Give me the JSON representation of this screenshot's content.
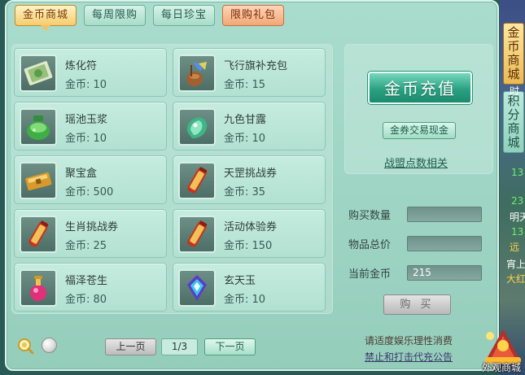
{
  "tabs": [
    {
      "label": "金币商城",
      "active": true
    },
    {
      "label": "每周限购",
      "active": false
    },
    {
      "label": "每日珍宝",
      "active": false
    },
    {
      "label": "限购礼包",
      "active": false
    }
  ],
  "items": [
    {
      "name": "炼化符",
      "price": "金币: 10",
      "icon": "talisman-icon"
    },
    {
      "name": "飞行旗补充包",
      "price": "金币: 15",
      "icon": "flag-pack-icon"
    },
    {
      "name": "瑶池玉浆",
      "price": "金币: 10",
      "icon": "jade-potion-icon"
    },
    {
      "name": "九色甘露",
      "price": "金币: 10",
      "icon": "dew-gem-icon"
    },
    {
      "name": "聚宝盒",
      "price": "金币: 500",
      "icon": "treasure-box-icon"
    },
    {
      "name": "天罡挑战券",
      "price": "金币: 35",
      "icon": "scroll-icon"
    },
    {
      "name": "生肖挑战券",
      "price": "金币: 25",
      "icon": "scroll-icon"
    },
    {
      "name": "活动体验券",
      "price": "金币: 150",
      "icon": "scroll-icon"
    },
    {
      "name": "福泽苍生",
      "price": "金币: 80",
      "icon": "perfume-bottle-icon"
    },
    {
      "name": "玄天玉",
      "price": "金币: 10",
      "icon": "xuantian-jade-icon"
    }
  ],
  "right": {
    "recharge_label": "金币充值",
    "exchange_label": "金券交易现金",
    "alliance_link": "战盟点数相关"
  },
  "form": {
    "quantity_label": "购买数量",
    "quantity_value": "",
    "total_label": "物品总价",
    "total_value": "",
    "current_label": "当前金币",
    "current_value": "215",
    "buy_label": "购 买"
  },
  "pagination": {
    "prev_label": "上一页",
    "page": "1/3",
    "next_label": "下一页"
  },
  "notice": {
    "line1": "请适度娱乐理性消费",
    "line2": "禁止和打击代充公告"
  },
  "side": {
    "tab1": "金币商城",
    "tab2": "积分商城",
    "outfit_label": "外观商城",
    "fragments": [
      "时",
      "13",
      "23",
      "明天",
      "13",
      "远",
      "宵上",
      "大红"
    ]
  },
  "colors": {
    "panel": "#a9dccd",
    "active_tab": "#f5cc6e",
    "special_tab": "#f0a777",
    "recharge": "#2aa182"
  }
}
